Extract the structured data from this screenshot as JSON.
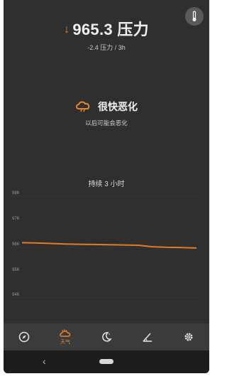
{
  "header": {
    "pressure_value": "965.3 压力",
    "trend_icon": "arrow-down-icon",
    "trend_text": "-2.4 压力 / 3h"
  },
  "forecast": {
    "icon": "cloud-rain-icon",
    "label": "很快恶化",
    "subtitle": "以后可能会恶化"
  },
  "duration_label": "持续 3 小时",
  "chart_data": {
    "type": "line",
    "title": "",
    "xlabel": "",
    "ylabel": "",
    "y_ticks": [
      "986",
      "976",
      "966",
      "956",
      "946"
    ],
    "ylim": [
      940,
      990
    ],
    "grid": true,
    "series": [
      {
        "x": [
          0,
          1,
          2,
          3,
          4,
          5,
          6,
          7,
          8,
          9,
          10,
          11,
          12
        ],
        "values": [
          967.7,
          967.6,
          967.4,
          967.2,
          967.1,
          967.0,
          966.9,
          966.8,
          966.7,
          966.1,
          965.9,
          965.8,
          965.6
        ]
      }
    ],
    "line_color": "#e07b28"
  },
  "bottom_nav": [
    {
      "name": "compass-icon",
      "label": ""
    },
    {
      "name": "weather-icon",
      "label": "天气"
    },
    {
      "name": "moon-night-icon",
      "label": ""
    },
    {
      "name": "angle-icon",
      "label": ""
    },
    {
      "name": "settings-gear-icon",
      "label": ""
    }
  ],
  "system_nav": {
    "back": "‹"
  },
  "colors": {
    "accent": "#e8852a",
    "background": "#2f2f2f",
    "nav_background": "#3b3b3b"
  }
}
